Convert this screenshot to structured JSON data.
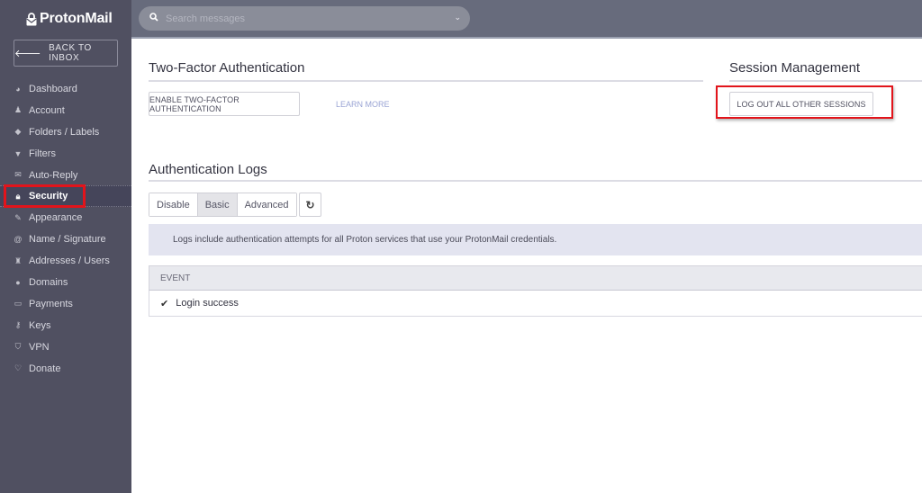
{
  "app": {
    "brand": "ProtonMail",
    "back_label": "BACK TO INBOX"
  },
  "sidebar": {
    "items": [
      {
        "label": "Dashboard",
        "icon": "dashboard-icon",
        "glyph": "◕"
      },
      {
        "label": "Account",
        "icon": "user-icon",
        "glyph": "♟"
      },
      {
        "label": "Folders / Labels",
        "icon": "tags-icon",
        "glyph": "◆"
      },
      {
        "label": "Filters",
        "icon": "filter-icon",
        "glyph": "▼"
      },
      {
        "label": "Auto-Reply",
        "icon": "envelope-open-icon",
        "glyph": "✉"
      },
      {
        "label": "Security",
        "icon": "lock-icon",
        "glyph": "🔒︎",
        "active": true
      },
      {
        "label": "Appearance",
        "icon": "paintbrush-icon",
        "glyph": "✎"
      },
      {
        "label": "Name / Signature",
        "icon": "at-icon",
        "glyph": "@"
      },
      {
        "label": "Addresses / Users",
        "icon": "users-icon",
        "glyph": "♜"
      },
      {
        "label": "Domains",
        "icon": "globe-icon",
        "glyph": "●"
      },
      {
        "label": "Payments",
        "icon": "credit-card-icon",
        "glyph": "▭"
      },
      {
        "label": "Keys",
        "icon": "key-icon",
        "glyph": "⚷"
      },
      {
        "label": "VPN",
        "icon": "shield-icon",
        "glyph": "⛉"
      },
      {
        "label": "Donate",
        "icon": "heart-icon",
        "glyph": "♡"
      }
    ]
  },
  "search": {
    "placeholder": "Search messages",
    "value": ""
  },
  "two_factor": {
    "title": "Two-Factor Authentication",
    "enable_label": "ENABLE TWO-FACTOR AUTHENTICATION",
    "learn_more_label": "LEARN MORE"
  },
  "session": {
    "title": "Session Management",
    "logout_label": "LOG OUT ALL OTHER SESSIONS"
  },
  "auth_logs": {
    "title": "Authentication Logs",
    "modes": [
      "Disable",
      "Basic",
      "Advanced"
    ],
    "selected_mode": "Basic",
    "notice": "Logs include authentication attempts for all Proton services that use your ProtonMail credentials.",
    "columns": [
      "EVENT"
    ],
    "rows": [
      {
        "event": "Login success",
        "status": "success"
      }
    ]
  },
  "colors": {
    "sidebar_bg": "#505061",
    "topbar_bg": "#676b7c",
    "highlight": "#e2141b",
    "link": "#9aa4d4"
  }
}
